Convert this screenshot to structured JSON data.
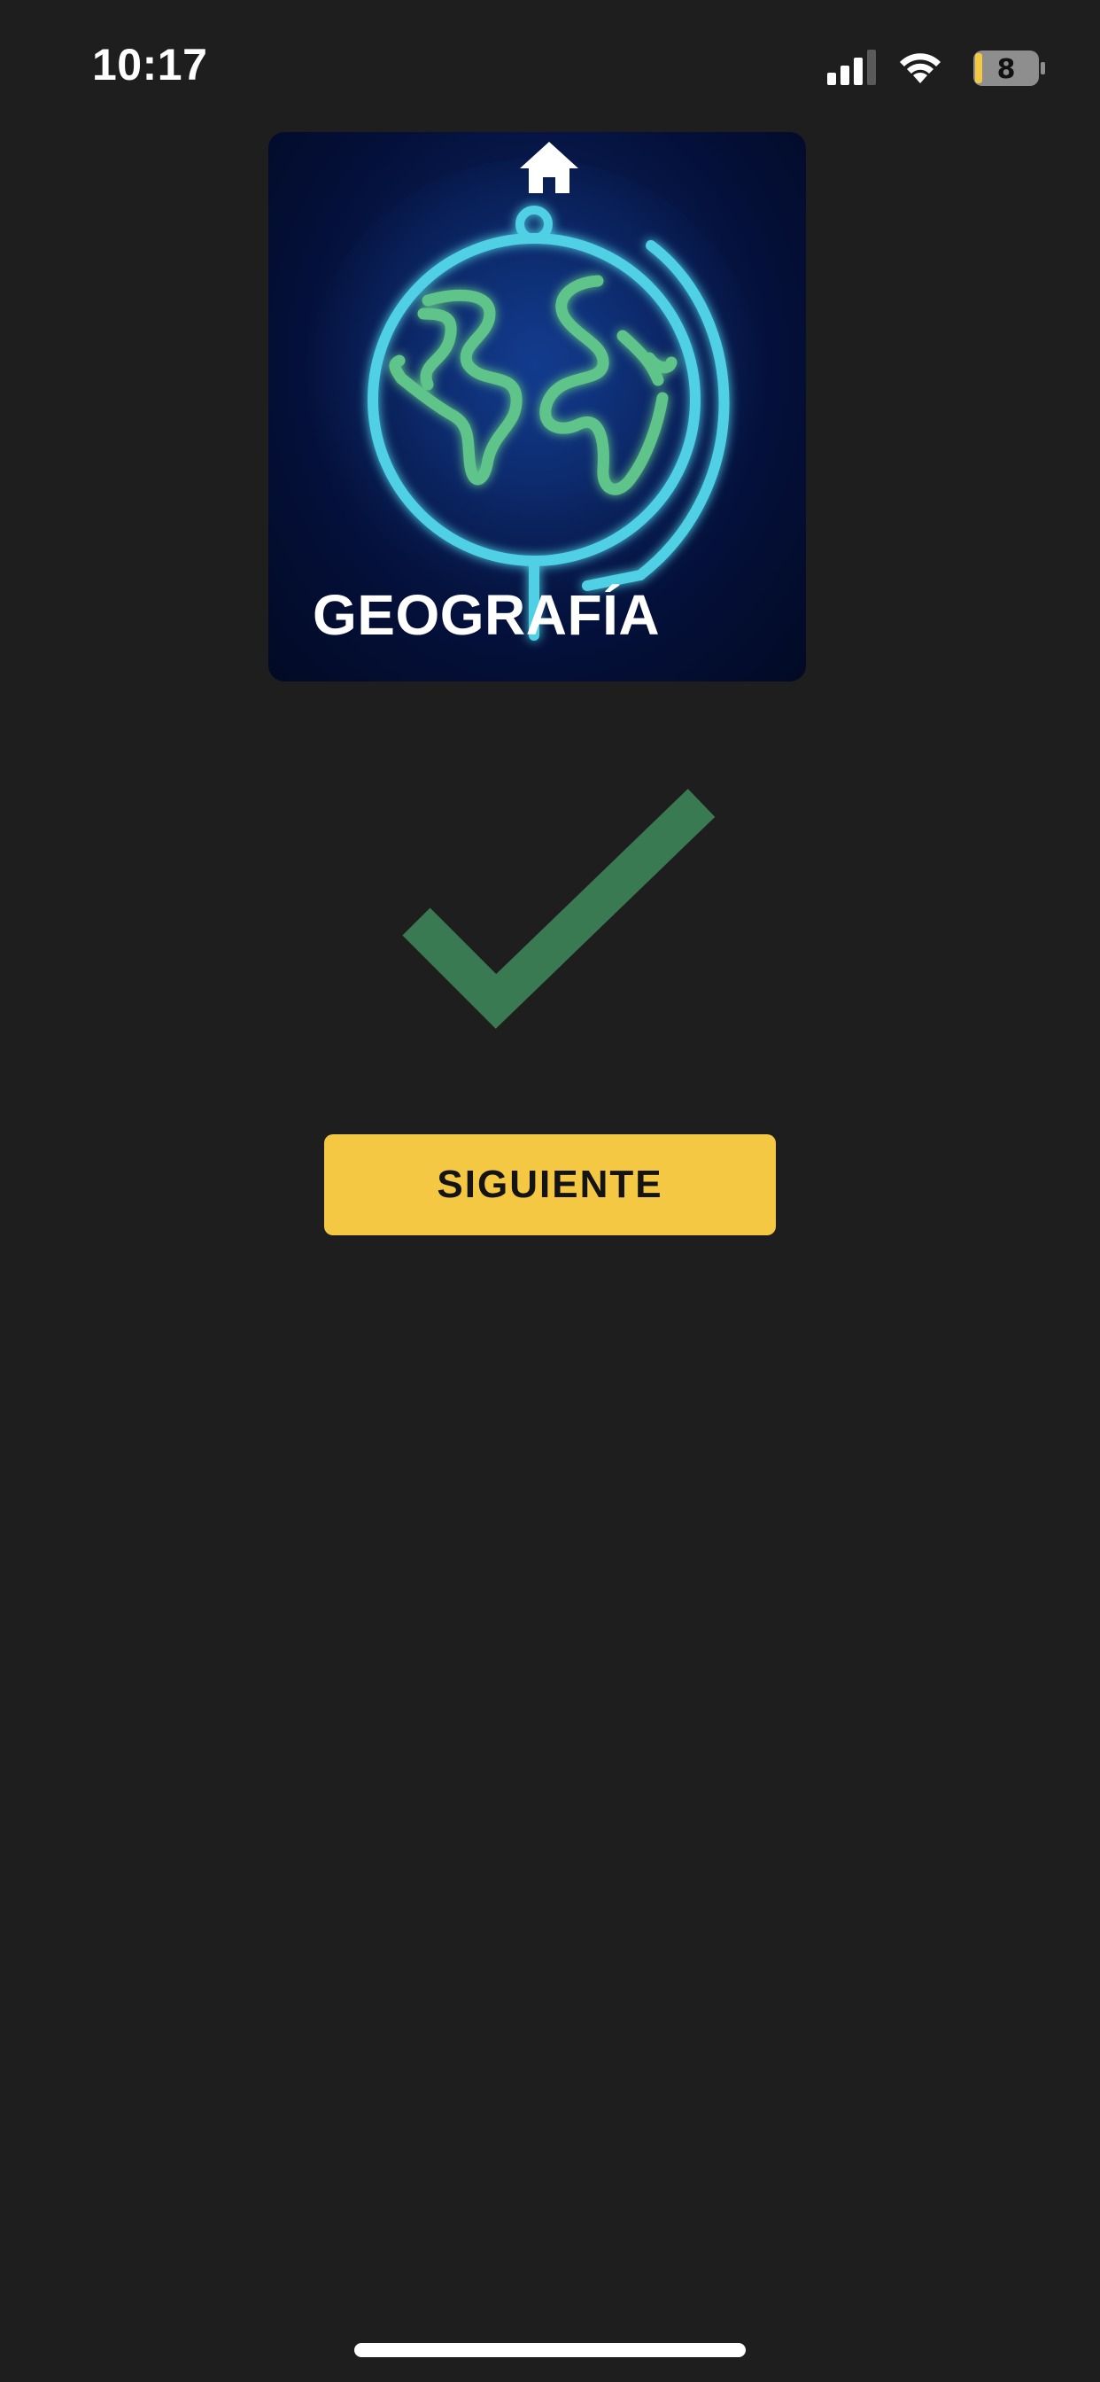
{
  "status_bar": {
    "time": "10:17",
    "battery_level": "8",
    "icons": [
      "cellular-signal-icon",
      "wifi-icon",
      "battery-icon"
    ]
  },
  "category": {
    "title": "GEOGRAFÍA",
    "image": "neon-globe-illustration",
    "home_icon": "home-icon"
  },
  "result": {
    "icon": "check-mark-icon",
    "color": "#3a7a52"
  },
  "actions": {
    "next_label": "SIGUIENTE",
    "next_color": "#f5c843"
  },
  "colors": {
    "background": "#1e1e1e",
    "card_background": "#04103a",
    "globe_stroke": "#4fd0e4",
    "continents": "#5fc48a"
  }
}
